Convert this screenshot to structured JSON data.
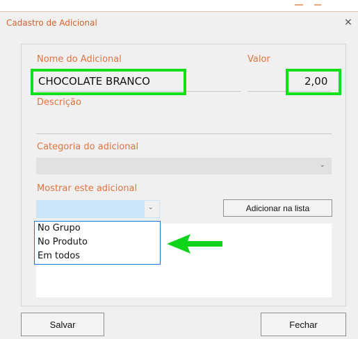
{
  "window": {
    "title": "Cadastro de Adicional",
    "close_glyph": "×"
  },
  "form": {
    "nome_label": "Nome do Adicional",
    "nome_value": "CHOCOLATE BRANCO",
    "valor_label": "Valor",
    "valor_value": "2,00",
    "descricao_label": "Descrição",
    "categoria_label": "Categoria do adicional",
    "mostrar_label": "Mostrar este adicional",
    "dropdown_options": [
      "No Grupo",
      "No Produto",
      "Em todos"
    ]
  },
  "buttons": {
    "adicionar": "Adicionar na lista",
    "salvar": "Salvar",
    "fechar": "Fechar"
  },
  "colors": {
    "label_orange": "#e2733f",
    "highlight_green": "#11e01a",
    "arrow_green": "#10d41b",
    "combo_gray": "#e1e1e1",
    "selected_blue": "#cce4f7"
  },
  "icons": {
    "dropdown_chevron": "chevron-down-icon",
    "close": "close-icon"
  }
}
